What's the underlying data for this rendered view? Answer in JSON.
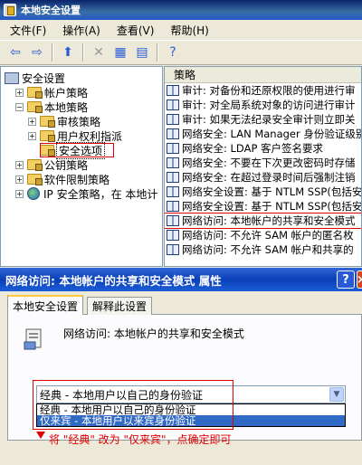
{
  "main_window": {
    "title": "本地安全设置",
    "menu": [
      "文件(F)",
      "操作(A)",
      "查看(V)",
      "帮助(H)"
    ]
  },
  "toolbar_icons": [
    "back-icon",
    "forward-icon",
    "up-folder-icon",
    "delete-icon",
    "properties-icon",
    "export-icon",
    "help-icon"
  ],
  "tree": {
    "root": "安全设置",
    "items": [
      {
        "label": "帐户策略",
        "indent": 1,
        "expander": "+"
      },
      {
        "label": "本地策略",
        "indent": 1,
        "expander": "−"
      },
      {
        "label": "审核策略",
        "indent": 2,
        "expander": "+"
      },
      {
        "label": "用户权利指派",
        "indent": 2,
        "expander": "+"
      },
      {
        "label": "安全选项",
        "indent": 2,
        "expander": "",
        "selected": true
      },
      {
        "label": "公钥策略",
        "indent": 1,
        "expander": "+"
      },
      {
        "label": "软件限制策略",
        "indent": 1,
        "expander": "+"
      },
      {
        "label": "IP 安全策略，在 本地计",
        "indent": 1,
        "expander": "+"
      }
    ]
  },
  "list": {
    "column": "策略",
    "rows": [
      "审计: 对备份和还原权限的使用进行审",
      "审计: 对全局系统对象的访问进行审计",
      "审计: 如果无法纪录安全审计则立即关",
      "网络安全: LAN Manager 身份验证级别",
      "网络安全: LDAP 客户签名要求",
      "网络安全: 不要在下次更改密码时存储",
      "网络安全: 在超过登录时间后强制注销",
      "网络安全设置: 基于 NTLM SSP(包括安",
      "网络安全设置: 基于 NTLM SSP(包括安",
      "网络访问: 本地帐户的共享和安全模式",
      "网络访问: 不允许 SAM 帐户的匿名枚",
      "网络访问: 不允许 SAM 帐户和共享的"
    ],
    "highlight_index": 9
  },
  "dialog": {
    "title": "网络访问: 本地帐户的共享和安全模式 属性",
    "tabs": [
      "本地安全设置",
      "解释此设置"
    ],
    "policy_name": "网络访问: 本地帐户的共享和安全模式",
    "combo_value": "经典 - 本地用户以自己的身份验证",
    "options": [
      "经典 - 本地用户以自己的身份验证",
      "仅来宾 - 本地用户以来宾身份验证"
    ],
    "selected_option": 1,
    "annotation": "将 \"经典\" 改为 \"仅来宾\"，点确定即可"
  },
  "colors": {
    "title_blue": "#0a246a",
    "dialog_title_blue": "#0a3fb8",
    "selection_blue": "#316ac5",
    "annotation_red": "#e00000"
  }
}
